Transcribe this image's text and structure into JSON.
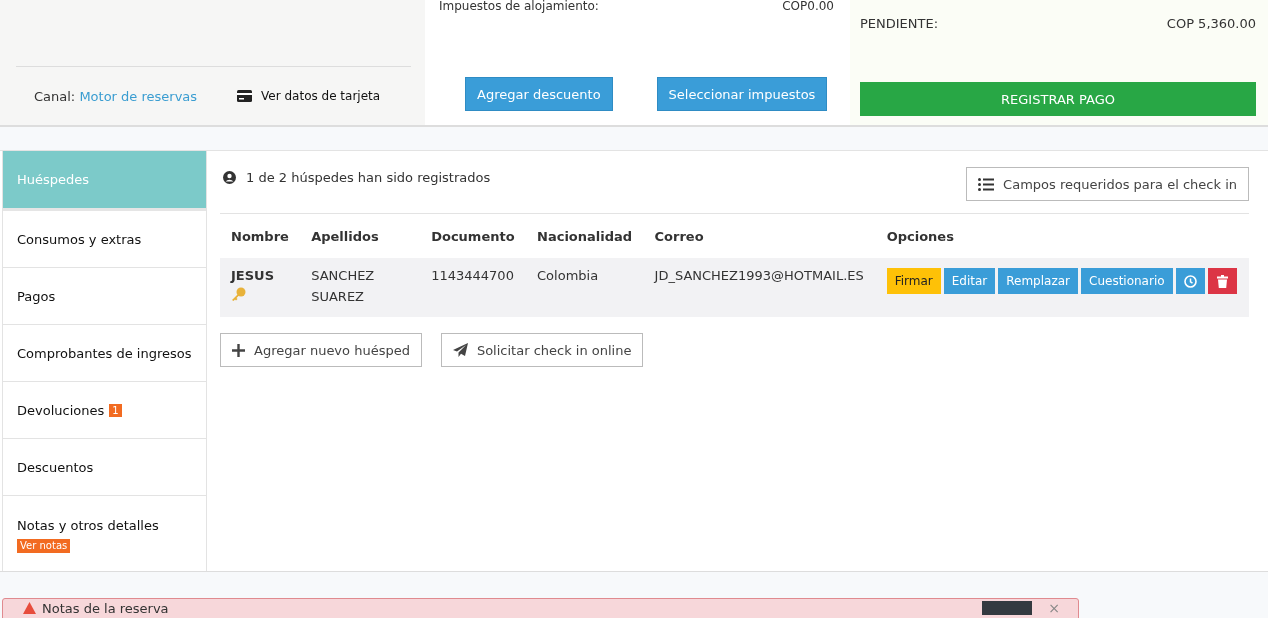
{
  "summary": {
    "tax_label": "Impuestos de alojamiento:",
    "tax_value": "COP0.00",
    "canal_label": "Canal:",
    "canal_value": "Motor de reservas",
    "card_link": "Ver datos de tarjeta",
    "buttons": [
      "Agregar descuento",
      "Seleccionar impuestos"
    ],
    "pending_label": "PENDIENTE:",
    "pending_value": "COP 5,360.00",
    "pay_button": "REGISTRAR PAGO"
  },
  "sidebar": {
    "items": [
      {
        "label": "Huéspedes",
        "selected": true
      },
      {
        "label": "Consumos y extras",
        "selected": false
      },
      {
        "label": "Pagos",
        "selected": false
      },
      {
        "label": "Comprobantes de ingresos",
        "selected": false
      },
      {
        "label": "Devoluciones",
        "selected": false,
        "badge": "1"
      },
      {
        "label": "Descuentos",
        "selected": false
      },
      {
        "label": "Notas y otros detalles",
        "selected": false,
        "tag": "Ver notas"
      }
    ]
  },
  "guests": {
    "status": "1 de 2 húspedes han sido registrados",
    "required_button": "Campos requeridos para el check in",
    "table": {
      "columns": [
        "Nombre",
        "Apellidos",
        "Documento",
        "Nacionalidad",
        "Correo",
        "Opciones"
      ],
      "rows": [
        {
          "nombre": "JESUS",
          "key": true,
          "apellidos": "SANCHEZ SUAREZ",
          "documento": "1143444700",
          "nacionalidad": "Colombia",
          "correo": "JD_SANCHEZ1993@HOTMAIL.ES",
          "options": [
            {
              "kind": "warning",
              "label": "Firmar"
            },
            {
              "kind": "primary",
              "label": "Editar"
            },
            {
              "kind": "primary",
              "label": "Remplazar"
            },
            {
              "kind": "primary",
              "label": "Cuestionario"
            },
            {
              "kind": "clock"
            },
            {
              "kind": "trash"
            }
          ]
        }
      ]
    },
    "actions": [
      {
        "kind": "plus",
        "label": "Agregar nuevo huésped"
      },
      {
        "kind": "send",
        "label": "Solicitar check in online"
      }
    ]
  },
  "alert": {
    "title": "Notas de la reserva",
    "close": "×"
  }
}
